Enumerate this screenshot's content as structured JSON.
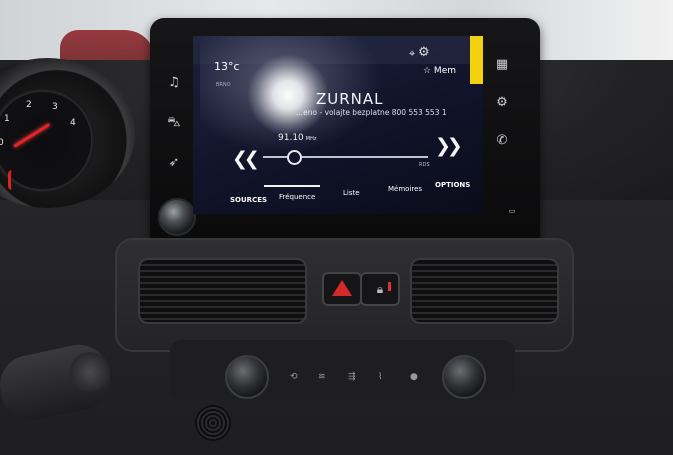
{
  "display": {
    "temperature": "13°c",
    "memory_label": "☆ Mem",
    "station_name": "ZURNAL",
    "rds_text": "...eno - volajte bezplatne 800 553 553 1",
    "frequency": "91.10",
    "frequency_unit": "MHz",
    "rds_badge": "RDS",
    "source_small": "BRNO",
    "tabs": [
      "SOURCES",
      "Fréquence",
      "Liste",
      "Mémoires",
      "OPTIONS"
    ],
    "active_tab": "Fréquence"
  },
  "gauge_numbers": [
    "0",
    "1",
    "2",
    "3",
    "4"
  ],
  "colors": {
    "accent_yellow": "#f2d20f",
    "hazard_red": "#d42a2a",
    "screen_bg": "#10142a"
  },
  "icons": {
    "left_panel": [
      "music-icon",
      "car-icon",
      "navigation-icon"
    ],
    "right_panel": [
      "apps-grid-icon",
      "settings-icon",
      "phone-icon"
    ]
  }
}
